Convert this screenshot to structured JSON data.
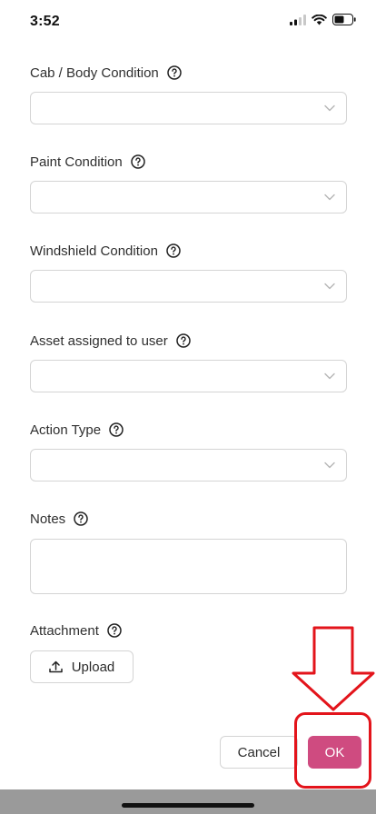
{
  "status_bar": {
    "time": "3:52"
  },
  "fields": [
    {
      "label": "Cab / Body Condition",
      "value": ""
    },
    {
      "label": "Paint Condition",
      "value": ""
    },
    {
      "label": "Windshield Condition",
      "value": ""
    },
    {
      "label": "Asset assigned to user",
      "value": ""
    },
    {
      "label": "Action Type",
      "value": ""
    }
  ],
  "notes": {
    "label": "Notes",
    "value": ""
  },
  "attachment": {
    "label": "Attachment",
    "upload_label": "Upload"
  },
  "actions": {
    "cancel_label": "Cancel",
    "ok_label": "OK"
  },
  "colors": {
    "ok_button": "#cf4b80",
    "highlight": "#e3141b",
    "border": "#d4d4d4"
  },
  "icons": [
    "signal-icon",
    "wifi-icon",
    "battery-icon",
    "help-icon",
    "chevron-down-icon",
    "upload-icon",
    "arrow-down-icon"
  ]
}
